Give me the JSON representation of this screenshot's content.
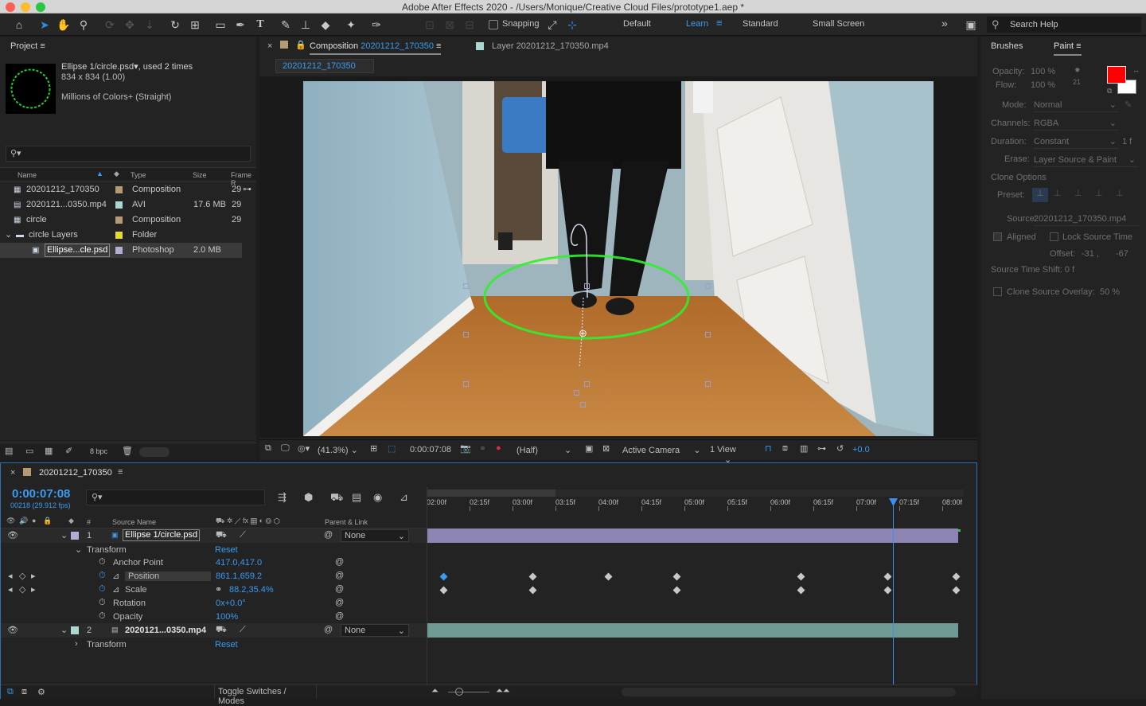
{
  "window": {
    "title": "Adobe After Effects 2020 - /Users/Monique/Creative Cloud Files/prototype1.aep *"
  },
  "toolbar": {
    "snapping": "Snapping",
    "workspaces": [
      "Default",
      "Learn",
      "Standard",
      "Small Screen"
    ],
    "search_placeholder": "Search Help"
  },
  "project": {
    "tab": "Project",
    "selected_name": "Ellipse 1/circle.psd",
    "used": ", used 2 times",
    "dims": "834 x 834 (1.00)",
    "colors": "Millions of Colors+ (Straight)",
    "columns": {
      "name": "Name",
      "type": "Type",
      "size": "Size",
      "frame": "Frame R"
    },
    "items": [
      {
        "name": "20201212_170350",
        "type": "Composition",
        "size": "",
        "frame": "29",
        "color": "#b59b73"
      },
      {
        "name": "2020121...0350.mp4",
        "type": "AVI",
        "size": "17.6 MB",
        "frame": "29",
        "color": "#a8d8d0"
      },
      {
        "name": "circle",
        "type": "Composition",
        "size": "",
        "frame": "29",
        "color": "#b59b73"
      },
      {
        "name": "circle Layers",
        "type": "Folder",
        "size": "",
        "frame": "",
        "color": "#e6d930"
      },
      {
        "name": "Ellipse...cle.psd",
        "type": "Photoshop",
        "size": "2.0 MB",
        "frame": "",
        "color": "#b4acd4"
      }
    ],
    "bpc": "8 bpc"
  },
  "comp": {
    "tab_prefix": "Composition",
    "tab_name": "20201212_170350",
    "layer_tab": "Layer 20201212_170350.mp4",
    "sub_tab": "20201212_170350",
    "zoom": "(41.3%)",
    "time": "0:00:07:08",
    "resolution": "(Half)",
    "camera": "Active Camera",
    "view": "1 View",
    "exposure": "+0.0"
  },
  "paint": {
    "tabs": [
      "Brushes",
      "Paint"
    ],
    "opacity_label": "Opacity:",
    "opacity": "100 %",
    "flow_label": "Flow:",
    "flow": "100 %",
    "brush_num": "21",
    "mode_label": "Mode:",
    "mode": "Normal",
    "channels_label": "Channels:",
    "channels": "RGBA",
    "duration_label": "Duration:",
    "duration": "Constant",
    "duration_f": "1 f",
    "erase_label": "Erase:",
    "erase": "Layer Source & Paint",
    "clone_options": "Clone Options",
    "preset_label": "Preset:",
    "source_label": "Source:",
    "source": "20201212_170350.mp4",
    "aligned": "Aligned",
    "lock_source": "Lock Source Time",
    "offset_label": "Offset:",
    "offset_x": "-31 ,",
    "offset_y": "-67",
    "shift": "Source Time Shift: 0 f",
    "overlay_label": "Clone Source Overlay:",
    "overlay": "50 %",
    "fg_color": "#ff0000",
    "bg_color": "#ffffff"
  },
  "timeline": {
    "tab": "20201212_170350",
    "timecode": "0:00:07:08",
    "frames": "00218 (29.912 fps)",
    "col_num": "#",
    "col_source": "Source Name",
    "col_parent": "Parent & Link",
    "ticks": [
      "02:00f",
      "02:15f",
      "03:00f",
      "03:15f",
      "04:00f",
      "04:15f",
      "05:00f",
      "05:15f",
      "06:00f",
      "06:15f",
      "07:00f",
      "07:15f",
      "08:00f"
    ],
    "layer1": {
      "num": "1",
      "name": "Ellipse 1/circle.psd",
      "parent": "None"
    },
    "layer2": {
      "num": "2",
      "name": "2020121...0350.mp4",
      "parent": "None"
    },
    "transform": "Transform",
    "reset": "Reset",
    "props": [
      {
        "name": "Anchor Point",
        "value": "417.0,417.0"
      },
      {
        "name": "Position",
        "value": "861.1,659.2"
      },
      {
        "name": "Scale",
        "value": "88.2,35.4%"
      },
      {
        "name": "Rotation",
        "value": "0x+0.0°"
      },
      {
        "name": "Opacity",
        "value": "100%"
      }
    ],
    "toggle": "Toggle Switches / Modes"
  }
}
